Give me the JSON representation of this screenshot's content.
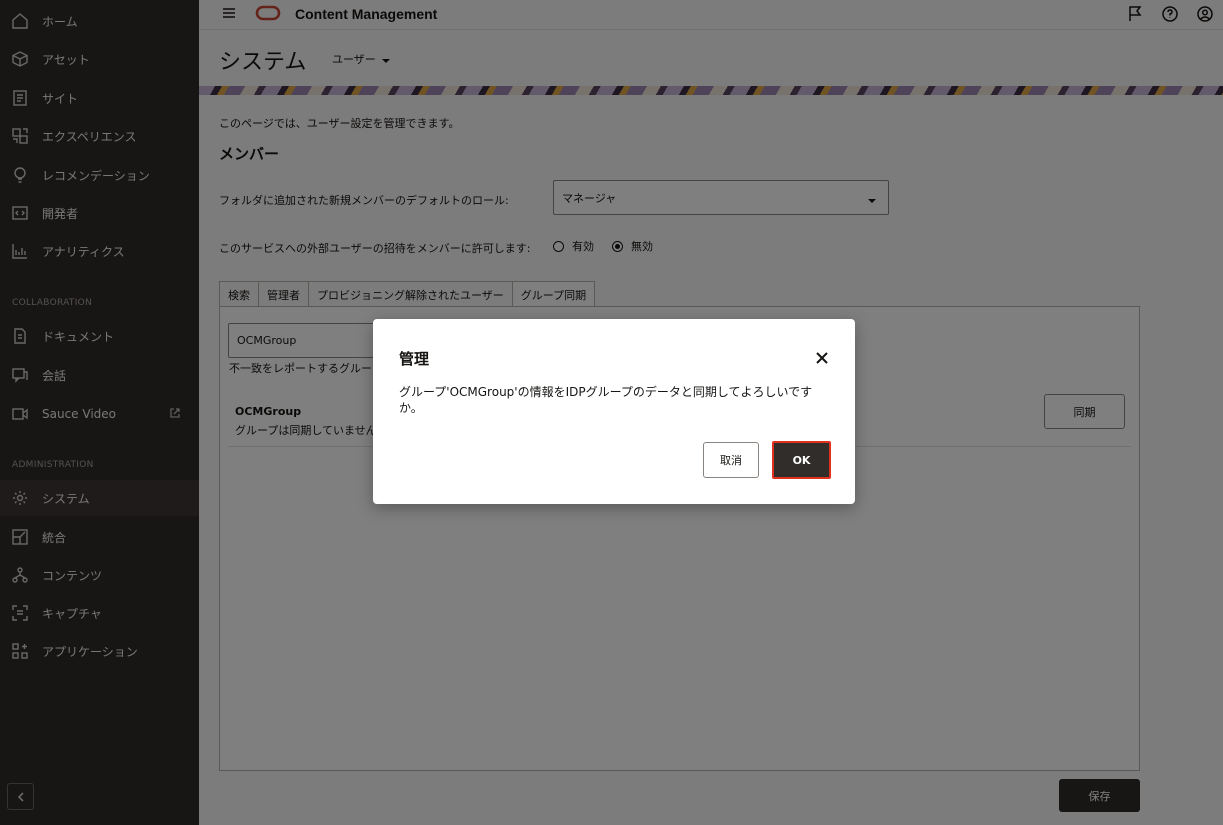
{
  "sidebar": {
    "items": [
      {
        "label": "ホーム",
        "icon": "home-icon"
      },
      {
        "label": "アセット",
        "icon": "cube-icon"
      },
      {
        "label": "サイト",
        "icon": "site-icon"
      },
      {
        "label": "エクスペリエンス",
        "icon": "experience-icon"
      },
      {
        "label": "レコメンデーション",
        "icon": "lightbulb-icon"
      },
      {
        "label": "開発者",
        "icon": "code-icon"
      },
      {
        "label": "アナリティクス",
        "icon": "analytics-icon"
      }
    ],
    "collaboration_label": "COLLABORATION",
    "collaboration_items": [
      {
        "label": "ドキュメント",
        "icon": "document-icon"
      },
      {
        "label": "会話",
        "icon": "conversation-icon"
      },
      {
        "label": "Sauce Video",
        "icon": "video-icon"
      }
    ],
    "administration_label": "ADMINISTRATION",
    "administration_items": [
      {
        "label": "システム",
        "icon": "gear-icon"
      },
      {
        "label": "統合",
        "icon": "integration-icon"
      },
      {
        "label": "コンテンツ",
        "icon": "content-icon"
      },
      {
        "label": "キャプチャ",
        "icon": "capture-icon"
      },
      {
        "label": "アプリケーション",
        "icon": "applications-icon"
      }
    ],
    "active": "システム"
  },
  "header": {
    "app_title": "Content Management",
    "icons": [
      "hamburger-icon",
      "oracle-logo-icon",
      "flag-icon",
      "help-icon",
      "user-icon"
    ]
  },
  "page": {
    "title": "システム",
    "user_menu": "ユーザー"
  },
  "main": {
    "description": "このページでは、ユーザー設定を管理できます。",
    "members_heading": "メンバー",
    "role_label": "フォルダに追加された新規メンバーのデフォルトのロール:",
    "role_value": "マネージャ",
    "invite_label": "このサービスへの外部ユーザーの招待をメンバーに許可します:",
    "invite_options": [
      {
        "label": "有効",
        "selected": false
      },
      {
        "label": "無効",
        "selected": true
      }
    ],
    "tabs": [
      {
        "label": "検索"
      },
      {
        "label": "管理者"
      },
      {
        "label": "プロビジョニング解除されたユーザー"
      },
      {
        "label": "グループ同期",
        "active": true
      }
    ],
    "group_input_value": "OCMGroup",
    "report_text": "不一致をレポートするグループ",
    "group_name": "OCMGroup",
    "group_status": "グループは同期していません",
    "sync_button": "同期",
    "save_button": "保存"
  },
  "dialog": {
    "title": "管理",
    "message": "グループ'OCMGroup'の情報をIDPグループのデータと同期してよろしいですか。",
    "cancel_label": "取消",
    "ok_label": "OK"
  },
  "colors": {
    "sidebar_bg": "#312d2a",
    "primary_button": "#312d2a",
    "focus_outline": "#e0301e",
    "logo": "#c74634"
  }
}
